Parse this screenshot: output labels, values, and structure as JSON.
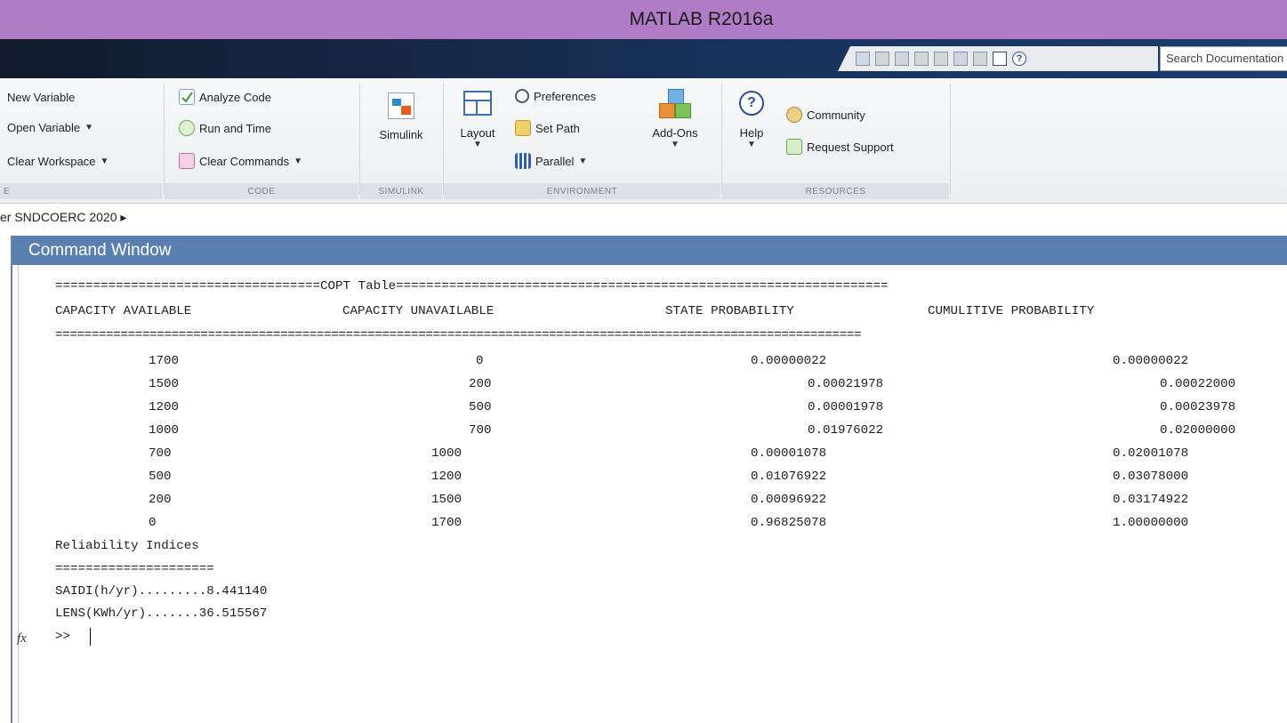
{
  "window": {
    "title": "MATLAB R2016a"
  },
  "quick_access": {
    "search_placeholder": "Search Documentation"
  },
  "ribbon": {
    "variable": {
      "new_variable": "New Variable",
      "open_variable": "Open Variable",
      "clear_workspace": "Clear Workspace",
      "label": "E"
    },
    "code": {
      "analyze_code": "Analyze Code",
      "run_and_time": "Run and Time",
      "clear_commands": "Clear Commands",
      "label": "CODE"
    },
    "simulink": {
      "button": "Simulink",
      "label": "SIMULINK"
    },
    "environment": {
      "layout": "Layout",
      "preferences": "Preferences",
      "set_path": "Set Path",
      "parallel": "Parallel",
      "add_ons": "Add-Ons",
      "label": "ENVIRONMENT"
    },
    "resources": {
      "help": "Help",
      "community": "Community",
      "request_support": "Request Support",
      "label": "RESOURCES"
    }
  },
  "breadcrumb": "er SNDCOERC 2020 ▸",
  "command_window": {
    "title": "Command Window",
    "banner": "===================================COPT Table=================================================================",
    "headers": [
      "CAPACITY AVAILABLE",
      "CAPACITY UNAVAILABLE",
      "STATE PROBABILITY",
      "CUMULITIVE PROBABILITY"
    ],
    "rule": "===============================================================================================================",
    "rows": [
      [
        "1700",
        "0",
        "0.00000022",
        "0.00000022"
      ],
      [
        "1500",
        "200",
        "0.00021978",
        "0.00022000"
      ],
      [
        "1200",
        "500",
        "0.00001978",
        "0.00023978"
      ],
      [
        "1000",
        "700",
        "0.01976022",
        "0.02000000"
      ],
      [
        "700",
        "1000",
        "0.00001078",
        "0.02001078"
      ],
      [
        "500",
        "1200",
        "0.01076922",
        "0.03078000"
      ],
      [
        "200",
        "1500",
        "0.00096922",
        "0.03174922"
      ],
      [
        "0",
        "1700",
        "0.96825078",
        "1.00000000"
      ]
    ],
    "reliability_title": "Reliability Indices",
    "reliability_rule": "=====================",
    "saidi": "SAIDI(h/yr).........8.441140",
    "lens": "LENS(KWh/yr).......36.515567",
    "prompt": ">>"
  }
}
